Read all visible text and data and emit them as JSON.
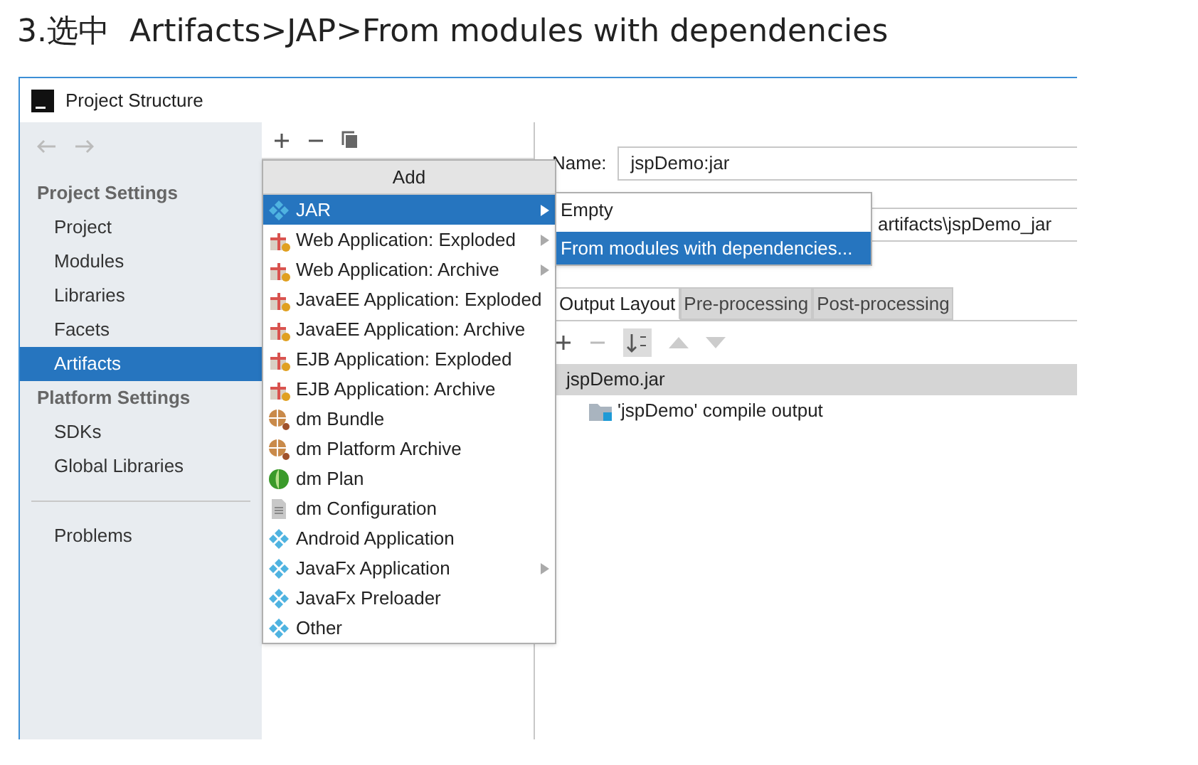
{
  "heading": "3.选中  Artifacts>JAP>From modules with dependencies",
  "window": {
    "title": "Project Structure"
  },
  "sidebar": {
    "sections": [
      {
        "title": "Project Settings",
        "items": [
          {
            "label": "Project",
            "selected": false
          },
          {
            "label": "Modules",
            "selected": false
          },
          {
            "label": "Libraries",
            "selected": false
          },
          {
            "label": "Facets",
            "selected": false
          },
          {
            "label": "Artifacts",
            "selected": true
          }
        ]
      },
      {
        "title": "Platform Settings",
        "items": [
          {
            "label": "SDKs",
            "selected": false
          },
          {
            "label": "Global Libraries",
            "selected": false
          }
        ]
      }
    ],
    "bottom_items": [
      {
        "label": "Problems",
        "selected": false
      }
    ]
  },
  "add_menu": {
    "title": "Add",
    "items": [
      {
        "label": "JAR",
        "kind": "diamond",
        "submenu": true,
        "selected": true
      },
      {
        "label": "Web Application: Exploded",
        "kind": "gift",
        "submenu": true,
        "selected": false
      },
      {
        "label": "Web Application: Archive",
        "kind": "gift",
        "submenu": true,
        "selected": false
      },
      {
        "label": "JavaEE Application: Exploded",
        "kind": "gift",
        "submenu": false,
        "selected": false
      },
      {
        "label": "JavaEE Application: Archive",
        "kind": "gift",
        "submenu": false,
        "selected": false
      },
      {
        "label": "EJB Application: Exploded",
        "kind": "gift",
        "submenu": false,
        "selected": false
      },
      {
        "label": "EJB Application: Archive",
        "kind": "gift",
        "submenu": false,
        "selected": false
      },
      {
        "label": "dm Bundle",
        "kind": "globe",
        "submenu": false,
        "selected": false
      },
      {
        "label": "dm Platform Archive",
        "kind": "globe",
        "submenu": false,
        "selected": false
      },
      {
        "label": "dm Plan",
        "kind": "plan",
        "submenu": false,
        "selected": false
      },
      {
        "label": "dm Configuration",
        "kind": "file",
        "submenu": false,
        "selected": false
      },
      {
        "label": "Android Application",
        "kind": "diamond",
        "submenu": false,
        "selected": false
      },
      {
        "label": "JavaFx Application",
        "kind": "diamond",
        "submenu": true,
        "selected": false
      },
      {
        "label": "JavaFx Preloader",
        "kind": "diamond",
        "submenu": false,
        "selected": false
      },
      {
        "label": "Other",
        "kind": "diamond",
        "submenu": false,
        "selected": false
      }
    ]
  },
  "jar_submenu": [
    {
      "label": "Empty",
      "selected": false
    },
    {
      "label": "From modules with dependencies...",
      "selected": true
    }
  ],
  "name_field": {
    "label": "Name:",
    "value": "jspDemo:jar"
  },
  "output_directory": {
    "value": "artifacts\\jspDemo_jar"
  },
  "tabs": [
    {
      "label": "Output Layout",
      "selected": true
    },
    {
      "label": "Pre-processing",
      "selected": false
    },
    {
      "label": "Post-processing",
      "selected": false
    }
  ],
  "tree": [
    {
      "label": "jspDemo.jar",
      "selected": true,
      "children": [
        {
          "label": "'jspDemo' compile output",
          "selected": false
        }
      ]
    }
  ]
}
